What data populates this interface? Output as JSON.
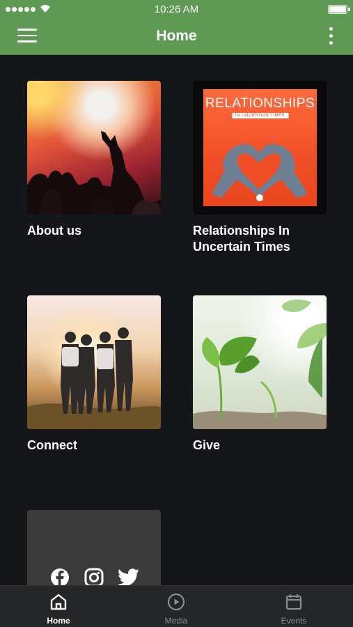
{
  "status_bar": {
    "time": "10:26 AM"
  },
  "header": {
    "title": "Home",
    "menu_icon": "hamburger-menu-icon",
    "more_icon": "vertical-ellipsis-icon",
    "background_color": "#5f9a55"
  },
  "tiles": [
    {
      "label": "About us",
      "image": "concert-crowd"
    },
    {
      "label": "Relationships In Uncertain Times",
      "image": "relationships-book-cover"
    },
    {
      "label": "Connect",
      "image": "friends-sunset"
    },
    {
      "label": "Give",
      "image": "green-sprouts"
    }
  ],
  "book_cover": {
    "title": "RELATIONSHIPS",
    "subtitle": "IN UNCERTAIN TIMES"
  },
  "social": {
    "icons": [
      "facebook-icon",
      "instagram-icon",
      "twitter-icon"
    ]
  },
  "tab_bar": {
    "active": "Home",
    "tabs": [
      {
        "label": "Home",
        "icon": "home-icon"
      },
      {
        "label": "Media",
        "icon": "play-circle-icon"
      },
      {
        "label": "Events",
        "icon": "calendar-icon"
      }
    ]
  }
}
